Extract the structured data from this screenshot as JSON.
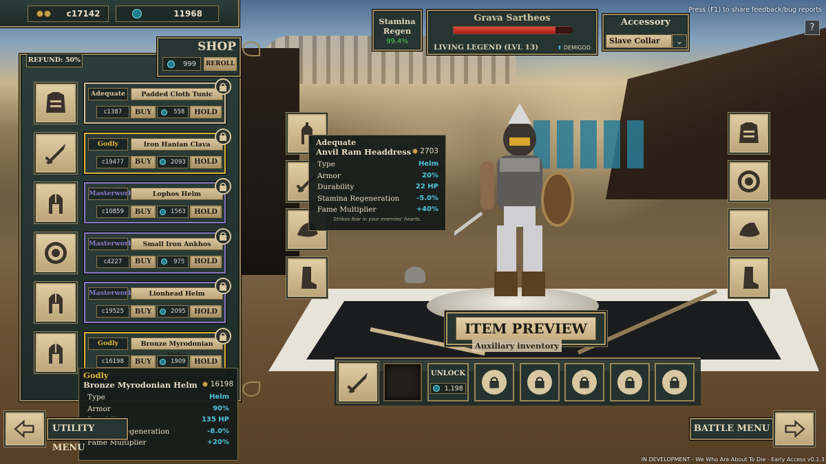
{
  "currency": {
    "coins": "c17142",
    "fame": "11968"
  },
  "stamina": {
    "label": "Stamina Regen",
    "value": "99.4%"
  },
  "gladiator": {
    "name": "Grava Sartheos",
    "rank": "LIVING LEGEND (LVL 13)",
    "tier": "DEMIGOD",
    "health_fraction": 0.85
  },
  "accessory": {
    "title": "Accessory",
    "selected": "Slave Collar"
  },
  "feedback_hint": "Press (F1) to share feedback/bug reports",
  "help_label": "?",
  "shop": {
    "title": "SHOP",
    "refund": "REFUND: 50%",
    "reroll_cost": "999",
    "reroll_label": "REROLL",
    "items": [
      {
        "quality": "Adequate",
        "name": "Padded Cloth Tunic",
        "cost": "c1387",
        "buy": "BUY",
        "fame": "558",
        "hold": "HOLD",
        "icon": "chest-armor-icon",
        "tier_color": "#d6c29a"
      },
      {
        "quality": "Godly",
        "name": "Iron Hanian Clava",
        "cost": "c19477",
        "buy": "BUY",
        "fame": "2093",
        "hold": "HOLD",
        "icon": "sword-icon",
        "tier_color": "#e0b53a"
      },
      {
        "quality": "Masterwork",
        "name": "Lophos Helm",
        "cost": "c10859",
        "buy": "BUY",
        "fame": "1563",
        "hold": "HOLD",
        "icon": "helmet-icon",
        "tier_color": "#8a7ac8"
      },
      {
        "quality": "Masterwork",
        "name": "Small Iron Ankhos",
        "cost": "c4227",
        "buy": "BUY",
        "fame": "975",
        "hold": "HOLD",
        "icon": "shield-icon",
        "tier_color": "#8a7ac8"
      },
      {
        "quality": "Masterwork",
        "name": "Lionhead Helm",
        "cost": "c19525",
        "buy": "BUY",
        "fame": "2095",
        "hold": "HOLD",
        "icon": "helmet-icon",
        "tier_color": "#8a7ac8"
      },
      {
        "quality": "Godly",
        "name": "Bronze Myrodonian Helm",
        "cost": "c16198",
        "buy": "BUY",
        "fame": "1909",
        "hold": "HOLD",
        "icon": "helmet-icon",
        "tier_color": "#e0b53a"
      }
    ]
  },
  "tooltip_equipped": {
    "quality": "Adequate",
    "name": "Anvil Ram Headdress",
    "price": "2703",
    "stats": [
      {
        "k": "Type",
        "v": "Helm"
      },
      {
        "k": "Armor",
        "v": "20%"
      },
      {
        "k": "Durability",
        "v": "22 HP"
      },
      {
        "k": "Stamina Regeneration",
        "v": "-5.0%"
      },
      {
        "k": "Fame Multiplier",
        "v": "+40%"
      }
    ],
    "flavor": "Strikes fear in your enemies' hearts."
  },
  "tooltip_shop": {
    "quality": "Godly",
    "name": "Bronze Myrodonian Helm",
    "price": "16198",
    "stats": [
      {
        "k": "Type",
        "v": "Helm"
      },
      {
        "k": "Armor",
        "v": "90%"
      },
      {
        "k": "Durability",
        "v": "135 HP"
      },
      {
        "k": "Stamina Regeneration",
        "v": "-8.0%"
      },
      {
        "k": "Fame Multiplier",
        "v": "+20%"
      }
    ]
  },
  "item_preview_label": "ITEM PREVIEW",
  "auxiliary_label": "Auxiliary inventory",
  "aux": {
    "unlock_label": "UNLOCK",
    "unlock_cost": "1,198"
  },
  "nav": {
    "utility": "UTILITY MENU",
    "battle": "BATTLE MENU"
  },
  "footer": "IN DEVELOPMENT - We Who Are About To Die - Early Access v0.1.3"
}
